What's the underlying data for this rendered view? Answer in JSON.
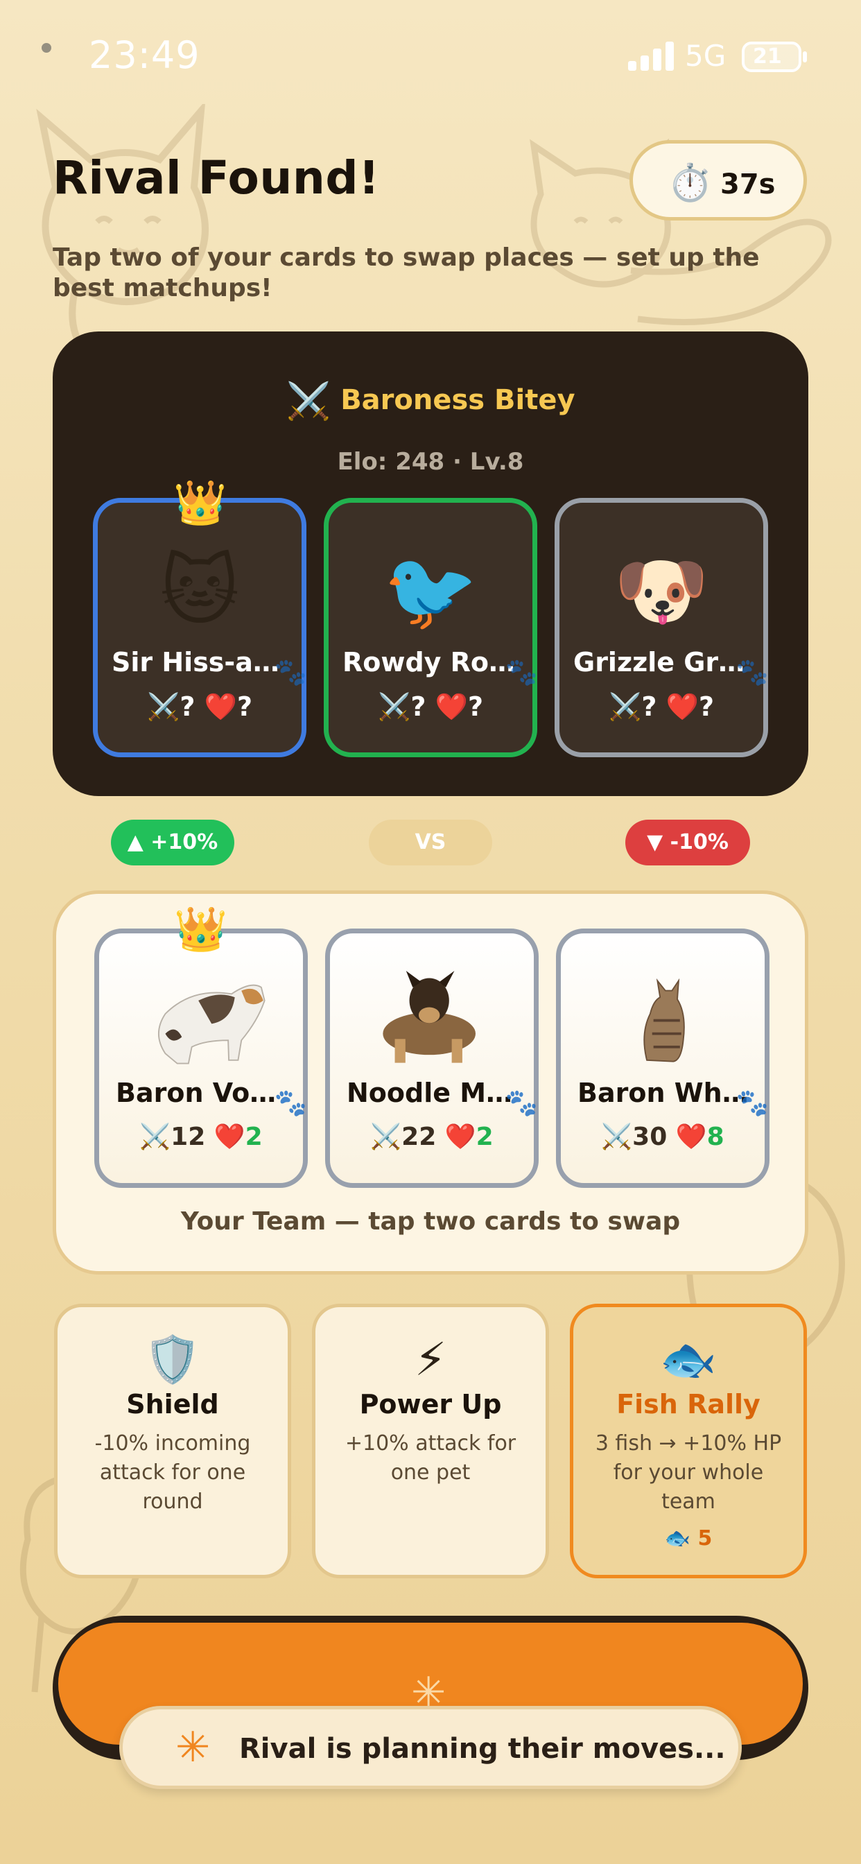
{
  "status_bar": {
    "time": "23:49",
    "network": "5G",
    "battery": "21"
  },
  "header": {
    "title": "Rival Found!",
    "timer_icon": "⏱️",
    "timer": "37s",
    "subtitle": "Tap two of your cards to swap places — set up the best matchups!"
  },
  "rival": {
    "icon": "crossed-swords-icon",
    "name": "Baroness Bitey",
    "elo": "Elo: 248 · Lv.8",
    "cards": [
      {
        "emoji": "🐱",
        "name": "Sir Hiss-a…",
        "attack": "?",
        "hp": "?",
        "border": "#3f7be0",
        "crown": true
      },
      {
        "emoji": "🐦",
        "name": "Rowdy Ro…",
        "attack": "?",
        "hp": "?",
        "border": "#22b24f",
        "crown": false
      },
      {
        "emoji": "🐶",
        "name": "Grizzle Gr…",
        "attack": "?",
        "hp": "?",
        "border": "#9aa0a8",
        "crown": false
      }
    ]
  },
  "modifiers": {
    "left": "▲ +10%",
    "vs": "VS",
    "right": "▼ -10%"
  },
  "team": {
    "cards": [
      {
        "name": "Baron Vo…",
        "attack": "12",
        "hp": "2",
        "crown": true
      },
      {
        "name": "Noodle M…",
        "attack": "22",
        "hp": "2",
        "crown": false
      },
      {
        "name": "Baron Wh…",
        "attack": "30",
        "hp": "8",
        "crown": false
      }
    ],
    "caption": "Your Team — tap two cards to swap"
  },
  "powerups": [
    {
      "icon": "🛡️",
      "title": "Shield",
      "desc": "-10% incoming attack for one round"
    },
    {
      "icon": "⚡",
      "title": "Power Up",
      "desc": "+10% attack for one pet"
    },
    {
      "icon": "🐟",
      "title": "Fish Rally",
      "desc": "3 fish → +10% HP for your whole team",
      "cost": "🐟 5"
    }
  ],
  "toast": {
    "text": "Rival is planning their moves..."
  },
  "colors": {
    "accent_orange": "#f0861f",
    "dark_panel": "#2a1f16",
    "gold": "#f7c852",
    "positive": "#22c05a",
    "negative": "#dd3f3f"
  }
}
